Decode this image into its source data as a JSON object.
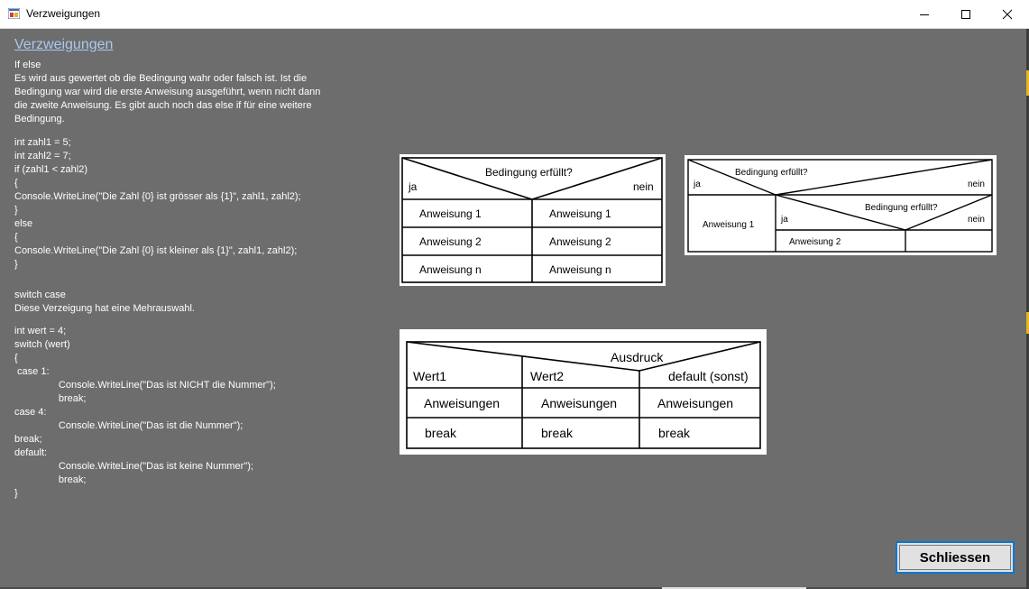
{
  "window": {
    "title": "Verzweigungen"
  },
  "heading": "Verzweigungen",
  "text": [
    "If else",
    "Es wird aus gewertet ob die Bedingung wahr oder falsch ist. Ist die",
    "Bedingung war wird die erste Anweisung ausgeführt, wenn nicht dann",
    "die zweite Anweisung. Es gibt auch noch das else if für eine weitere",
    "Bedingung.",
    "int zahl1 = 5;",
    "int zahl2 = 7;",
    "if (zahl1 < zahl2)",
    "{",
    "Console.WriteLine(\"Die Zahl {0} ist grösser als {1}\", zahl1, zahl2);",
    "}",
    "else",
    "{",
    "Console.WriteLine(\"Die Zahl {0} ist kleiner als {1}\", zahl1, zahl2);",
    "}",
    "switch case",
    "Diese Verzeigung hat eine Mehrauswahl.",
    "int wert = 4;",
    "switch (wert)",
    "{",
    " case 1:",
    "                Console.WriteLine(\"Das ist NICHT die Nummer\");",
    "                break;",
    "case 4:",
    "                Console.WriteLine(\"Das ist die Nummer\");",
    "break;",
    "default:",
    "                Console.WriteLine(\"Das ist keine Nummer\");",
    "                break;",
    "}"
  ],
  "diagram_if": {
    "condition": "Bedingung erfüllt?",
    "yes": "ja",
    "no": "nein",
    "left": [
      "Anweisung 1",
      "Anweisung 2",
      "Anweisung n"
    ],
    "right": [
      "Anweisung 1",
      "Anweisung 2",
      "Anweisung n"
    ]
  },
  "diagram_nested": {
    "condition": "Bedingung erfüllt?",
    "yes": "ja",
    "no": "nein",
    "left": "Anweisung 1",
    "inner_condition": "Bedingung erfüllt?",
    "inner_yes": "ja",
    "inner_no": "nein",
    "inner_left": "Anweisung 2"
  },
  "diagram_switch": {
    "expression": "Ausdruck",
    "cases": [
      "Wert1",
      "Wert2",
      "default (sonst)"
    ],
    "statements": [
      "Anweisungen",
      "Anweisungen",
      "Anweisungen"
    ],
    "breaks": [
      "break",
      "break",
      "break"
    ]
  },
  "buttons": {
    "close": "Schliessen"
  },
  "colors": {
    "background": "#6d6d6d",
    "heading_link": "#a9c8f0",
    "focus_border": "#0078d7"
  },
  "icons": [
    "app-icon",
    "minimize-icon",
    "maximize-icon",
    "close-icon"
  ]
}
